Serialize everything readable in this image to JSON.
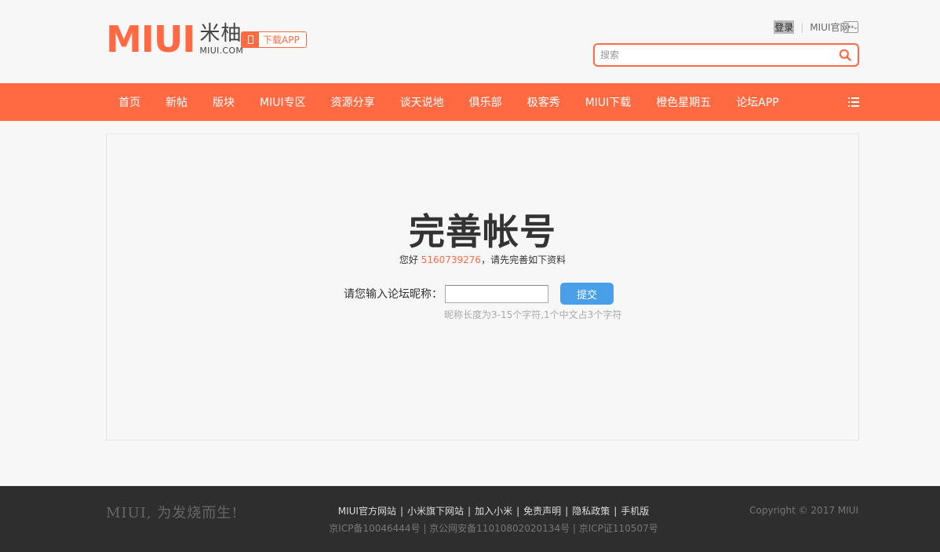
{
  "header": {
    "logo_text": "MIUI",
    "logo_cn": "米柚",
    "logo_en": "MIUI.COM",
    "download_app": "下载APP",
    "login": "登录",
    "separator": "|",
    "official_site": "MIUI官网",
    "search_placeholder": "搜索"
  },
  "nav": {
    "items": [
      "首页",
      "新帖",
      "版块",
      "MIUI专区",
      "资源分享",
      "谈天说地",
      "俱乐部",
      "极客秀",
      "MIUI下载",
      "橙色星期五",
      "论坛APP"
    ]
  },
  "main": {
    "title": "完善帐号",
    "greeting_prefix": "您好 ",
    "user_id": "5160739276",
    "greeting_suffix": "，请先完善如下资料",
    "nickname_label": "请您输入论坛昵称：",
    "nickname_value": "",
    "submit_label": "提交",
    "hint": "昵称长度为3-15个字符,1个中文占3个字符"
  },
  "footer": {
    "slogan": "MIUI, 为发烧而生!",
    "links": [
      "MIUI官方网站",
      "小米旗下网站",
      "加入小米",
      "免责声明",
      "隐私政策",
      "手机版"
    ],
    "link_separator": "|",
    "icp": "京ICP备10046444号 | 京公网安备11010802020134号 | 京ICP证110507号",
    "copyright": "Copyright © 2017 MIUI"
  },
  "colors": {
    "brand": "#ff6a43",
    "submit": "#4aa0e8",
    "footer_bg": "#2e2e2e"
  },
  "icons": [
    "phone-icon",
    "chevron-down-icon",
    "expand-icon",
    "search-icon",
    "menu-list-icon"
  ]
}
